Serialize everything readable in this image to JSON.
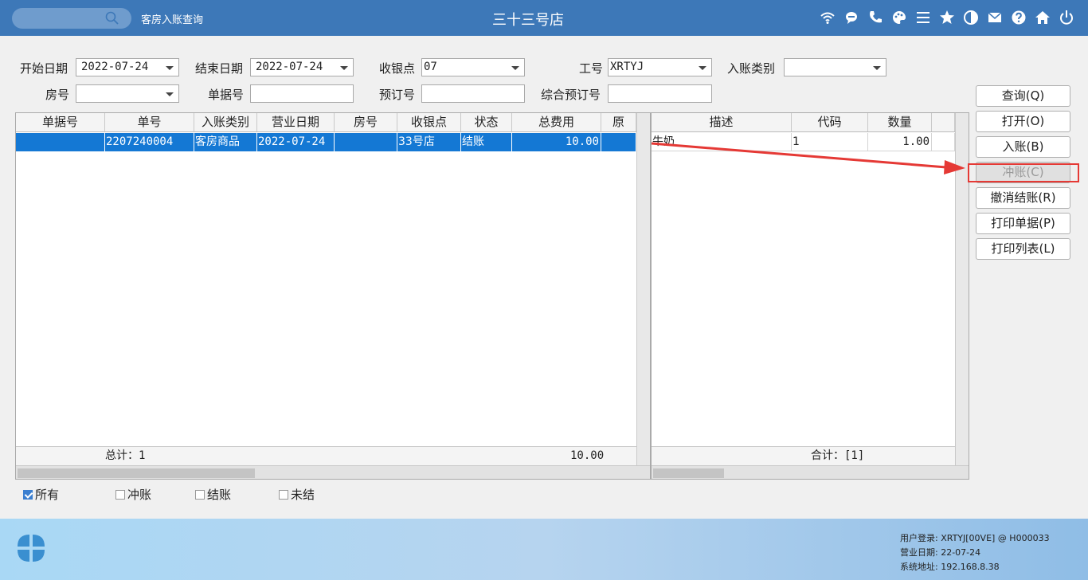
{
  "header": {
    "module_title": "客房入账查询",
    "store_title": "三十三号店",
    "icons": [
      "wifi-icon",
      "chat-icon",
      "phone-icon",
      "palette-icon",
      "menu-icon",
      "star-icon",
      "theme-icon",
      "mail-icon",
      "help-icon",
      "home-icon",
      "power-icon"
    ]
  },
  "filters": {
    "start_date_label": "开始日期",
    "start_date": "2022-07-24",
    "end_date_label": "结束日期",
    "end_date": "2022-07-24",
    "cashier_label": "收银点",
    "cashier": "07",
    "staff_label": "工号",
    "staff": "XRTYJ",
    "posting_type_label": "入账类别",
    "posting_type": "",
    "room_label": "房号",
    "room": "",
    "voucher_label": "单据号",
    "voucher": "",
    "booking_label": "预订号",
    "booking": "",
    "combined_booking_label": "综合预订号",
    "combined_booking": ""
  },
  "main_grid": {
    "columns": [
      "单据号",
      "单号",
      "入账类别",
      "营业日期",
      "房号",
      "收银点",
      "状态",
      "总费用",
      "原"
    ],
    "rows": [
      {
        "voucher": "",
        "order_no": "2207240004",
        "type": "客房商品",
        "date": "2022-07-24",
        "room": "",
        "cashier": "33号店",
        "status": "结账",
        "total": "10.00",
        "orig": ""
      }
    ],
    "footer_count_label": "总计：1",
    "footer_total": "10.00"
  },
  "detail_grid": {
    "columns": [
      "描述",
      "代码",
      "数量"
    ],
    "rows": [
      {
        "desc": "牛奶",
        "code": "1",
        "qty": "1.00"
      }
    ],
    "footer_label": "合计：[1]"
  },
  "buttons": {
    "query": "查询(Q)",
    "open": "打开(O)",
    "post": "入账(B)",
    "reverse": "冲账(C)",
    "cancel_checkout": "撤消结账(R)",
    "print_doc": "打印单据(P)",
    "print_list": "打印列表(L)"
  },
  "checkboxes": {
    "all": "所有",
    "reversed": "冲账",
    "settled": "结账",
    "unsettled": "未结",
    "all_checked": true
  },
  "status": {
    "user": "用户登录:  XRTYJ[00VE] @ H000033",
    "business_date": "营业日期:  22-07-24",
    "system_address": "系统地址:  192.168.8.38"
  },
  "colors": {
    "header_bg": "#3d78b8",
    "selection": "#1478d4",
    "annotation_red": "#e53935"
  }
}
